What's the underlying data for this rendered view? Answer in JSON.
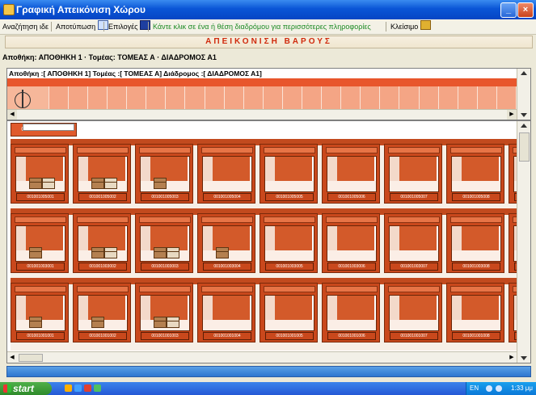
{
  "window": {
    "title": "Γραφική Απεικόνιση Χώρου"
  },
  "menu": {
    "items": [
      {
        "label": "Αναζήτηση ιδε"
      },
      {
        "label": "Αποτύπωση"
      },
      {
        "label": "Επιλογές"
      },
      {
        "label": "Κάντε κλικ σε ένα ή θέση διαδρόμου για περισσότερες πληροφορίες"
      },
      {
        "label": "Κλείσιμο"
      }
    ],
    "icons": [
      "document-icon",
      "calendar-icon",
      "door-icon"
    ]
  },
  "header": {
    "title": "ΑΠΕΙΚΟΝΙΣΗ ΒΑΡΟΥΣ"
  },
  "location": {
    "summary": "Αποθήκη: ΑΠΟΘΗΚΗ 1 · Τομέας: ΤΟΜΕΑΣ Α · ΔΙΑΔΡΟΜΟΣ Α1"
  },
  "overview": {
    "title": "Αποθήκη :[ ΑΠΟΘΗΚΗ 1] Τομέας :[ ΤΟΜΕΑΣ Α] Διάδρομος :[ ΔΙΑΔΡΟΜΟΣ Α1]",
    "strip_cells": 24
  },
  "aisle": {
    "selected_label": "001001-NA01-NA"
  },
  "grid": {
    "columns": 9,
    "rows": [
      {
        "level": "05",
        "codes": [
          "001001005001",
          "001001005002",
          "001001005003",
          "001001005004",
          "001001005005",
          "001001005006",
          "001001005007",
          "001001005008",
          "001001005009"
        ],
        "packages": [
          2,
          2,
          1,
          0,
          0,
          0,
          0,
          0,
          0
        ]
      },
      {
        "level": "03",
        "codes": [
          "001001003001",
          "001001003002",
          "001001003003",
          "001001003004",
          "001001003005",
          "001001003006",
          "001001003007",
          "001001003008",
          "001001003009"
        ],
        "packages": [
          1,
          2,
          2,
          1,
          0,
          0,
          0,
          0,
          0
        ]
      },
      {
        "level": "01",
        "codes": [
          "001001001001",
          "001001001002",
          "001001001003",
          "001001001004",
          "001001001005",
          "001001001006",
          "001001001007",
          "001001001008",
          "001001001009"
        ],
        "packages": [
          1,
          1,
          2,
          0,
          0,
          0,
          0,
          0,
          0
        ]
      }
    ]
  },
  "taskbar": {
    "start_label": "start",
    "language": "EN",
    "clock": "1:33 μμ"
  },
  "colors": {
    "accent": "#e05a2c",
    "title_red": "#d02a0c",
    "xp_blue": "#0a55d6"
  }
}
